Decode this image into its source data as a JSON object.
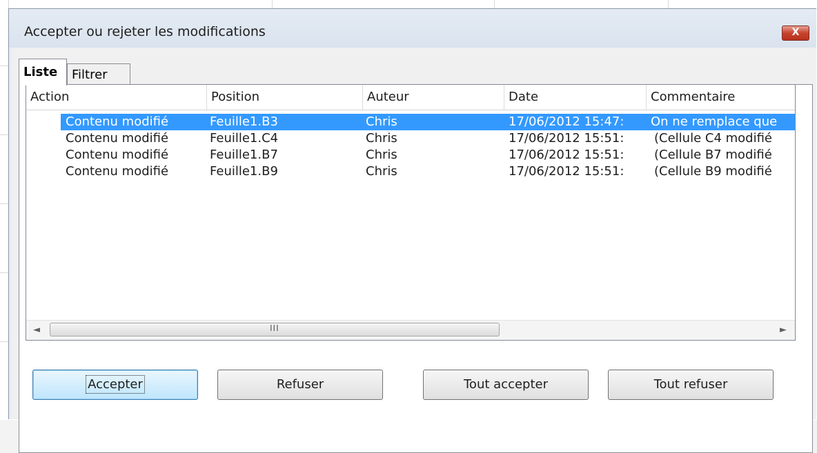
{
  "dialog": {
    "title": "Accepter ou rejeter les modifications",
    "close_label": "X"
  },
  "tabs": [
    {
      "label": "Liste",
      "active": true
    },
    {
      "label": "Filtrer",
      "active": false
    }
  ],
  "list": {
    "columns": [
      "Action",
      "Position",
      "Auteur",
      "Date",
      "Commentaire"
    ],
    "rows": [
      {
        "action": "Contenu modifié",
        "position": "Feuille1.B3",
        "author": "Chris",
        "date": "17/06/2012 15:47:",
        "comment": "On ne remplace que",
        "selected": true
      },
      {
        "action": "Contenu modifié",
        "position": "Feuille1.C4",
        "author": "Chris",
        "date": "17/06/2012 15:51:",
        "comment": "(Cellule C4 modifié",
        "selected": false
      },
      {
        "action": "Contenu modifié",
        "position": "Feuille1.B7",
        "author": "Chris",
        "date": "17/06/2012 15:51:",
        "comment": "(Cellule B7 modifié",
        "selected": false
      },
      {
        "action": "Contenu modifié",
        "position": "Feuille1.B9",
        "author": "Chris",
        "date": "17/06/2012 15:51:",
        "comment": "(Cellule B9 modifié",
        "selected": false
      }
    ],
    "scroll_left": "◄",
    "scroll_right": "►",
    "scroll_grip": "III"
  },
  "buttons": {
    "accept": "Accepter",
    "refuse": "Refuser",
    "accept_all": "Tout accepter",
    "refuse_all": "Tout refuser"
  },
  "colors": {
    "selection": "#3399ff",
    "close_button": "#c7432e"
  }
}
